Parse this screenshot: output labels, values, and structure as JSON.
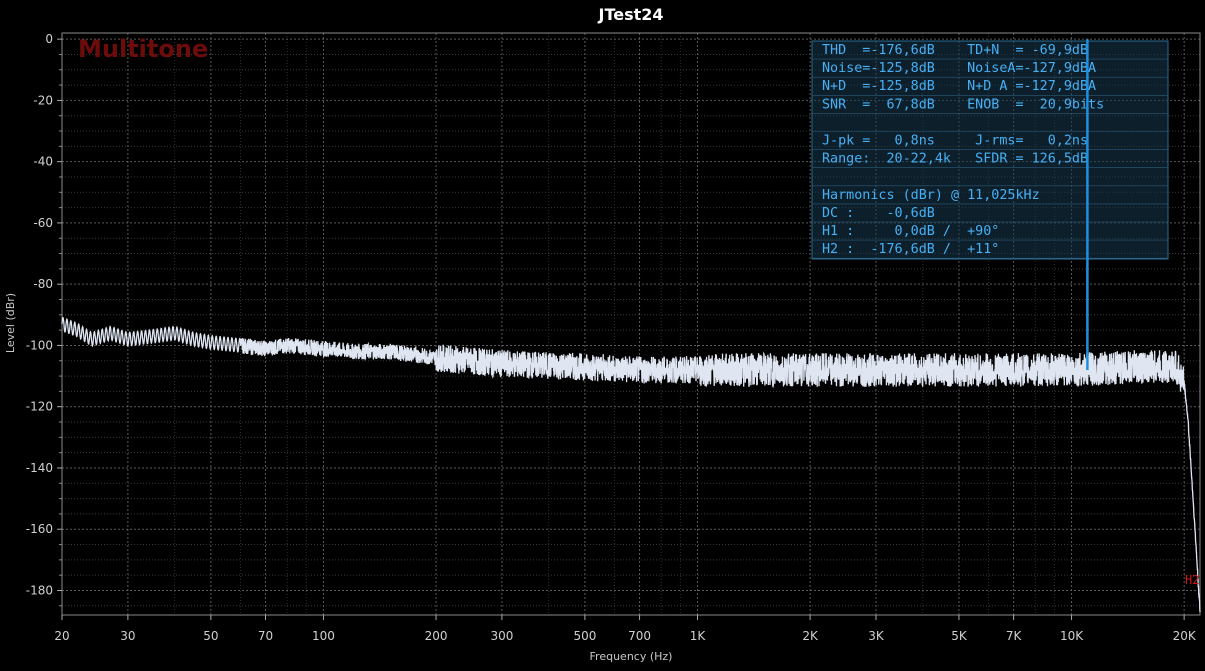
{
  "chart_data": {
    "type": "line",
    "title": "JTest24",
    "watermark": "Multitone",
    "xlabel": "Frequency (Hz)",
    "ylabel": "Level (dBr)",
    "xscale": "log",
    "xlim": [
      20,
      22050
    ],
    "ylim": [
      -188,
      2
    ],
    "x_ticks": [
      {
        "value": 20,
        "label": "20"
      },
      {
        "value": 30,
        "label": "30"
      },
      {
        "value": 50,
        "label": "50"
      },
      {
        "value": 70,
        "label": "70"
      },
      {
        "value": 100,
        "label": "100"
      },
      {
        "value": 200,
        "label": "200"
      },
      {
        "value": 300,
        "label": "300"
      },
      {
        "value": 500,
        "label": "500"
      },
      {
        "value": 700,
        "label": "700"
      },
      {
        "value": 1000,
        "label": "1K"
      },
      {
        "value": 2000,
        "label": "2K"
      },
      {
        "value": 3000,
        "label": "3K"
      },
      {
        "value": 5000,
        "label": "5K"
      },
      {
        "value": 7000,
        "label": "7K"
      },
      {
        "value": 10000,
        "label": "10K"
      },
      {
        "value": 20000,
        "label": "20K"
      }
    ],
    "y_ticks": [
      0,
      -20,
      -40,
      -60,
      -80,
      -100,
      -120,
      -140,
      -160,
      -180
    ],
    "grid": true,
    "series": [
      {
        "color": "#dfe6f2",
        "points": [
          [
            20,
            -93
          ],
          [
            22,
            -95
          ],
          [
            24,
            -98
          ],
          [
            27,
            -96
          ],
          [
            30,
            -98
          ],
          [
            35,
            -97
          ],
          [
            40,
            -96
          ],
          [
            45,
            -98
          ],
          [
            50,
            -99
          ],
          [
            60,
            -100
          ],
          [
            70,
            -101
          ],
          [
            80,
            -100
          ],
          [
            100,
            -101
          ],
          [
            120,
            -102
          ],
          [
            150,
            -102
          ],
          [
            200,
            -104
          ],
          [
            300,
            -106
          ],
          [
            500,
            -107
          ],
          [
            700,
            -108
          ],
          [
            1000,
            -108
          ],
          [
            2000,
            -108
          ],
          [
            3000,
            -108
          ],
          [
            5000,
            -108
          ],
          [
            7000,
            -108
          ],
          [
            10000,
            -108
          ],
          [
            15000,
            -107
          ],
          [
            19000,
            -107
          ],
          [
            20000,
            -112
          ],
          [
            20500,
            -125
          ],
          [
            21000,
            -145
          ],
          [
            21500,
            -165
          ],
          [
            22050,
            -187
          ]
        ]
      },
      {
        "name": "H1",
        "color": "#1f8fe0",
        "points": [
          [
            11025,
            0
          ]
        ]
      }
    ],
    "markers": [
      {
        "label": "H2",
        "x": 22050,
        "y": -176.6,
        "color": "#cc1a1a"
      }
    ],
    "stats": [
      "THD  =-176,6dB    TD+N  = -69,9dB",
      "Noise=-125,8dB    NoiseA=-127,9dBA",
      "N+D  =-125,8dB    N+D A =-127,9dBA",
      "SNR  =  67,8dB    ENOB  =  20,9bits",
      "",
      "J-pk =   0,8ns     J-rms=   0,2ns",
      "Range:  20-22,4k   SFDR = 126,5dB",
      "",
      "Harmonics (dBr) @ 11,025kHz",
      "DC :    -0,6dB",
      "H1 :     0,0dB /  +90°",
      "H2 :  -176,6dB /  +11°"
    ]
  }
}
